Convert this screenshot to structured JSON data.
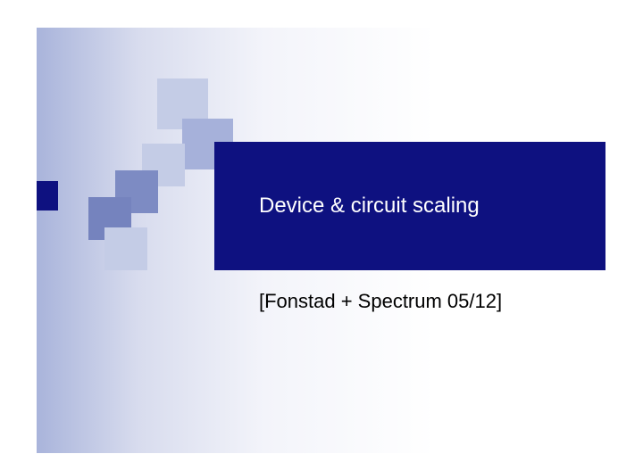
{
  "slide": {
    "title": "Device & circuit scaling",
    "subtitle": "[Fonstad + Spectrum 05/12]"
  },
  "colors": {
    "navy": "#0e1180",
    "sq_light": "#c4cce6",
    "sq_mid1": "#a6b1da",
    "sq_mid2": "#7d8bc3",
    "sq_mid3": "#7583be"
  }
}
